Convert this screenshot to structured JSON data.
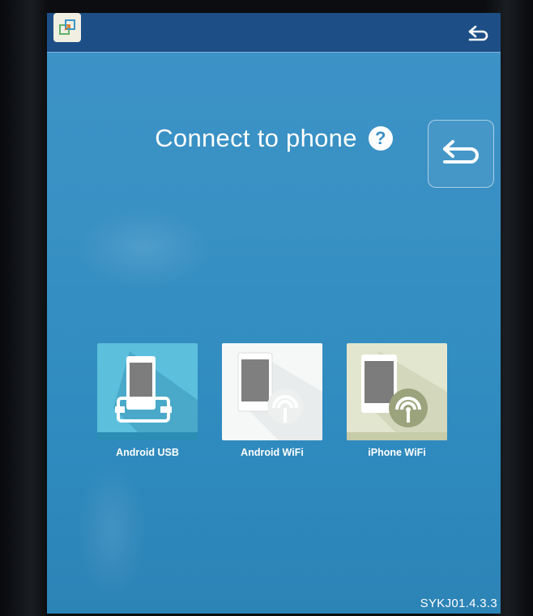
{
  "page": {
    "title": "Connect to phone",
    "help_symbol": "?",
    "version": "SYKJ01.4.3.3"
  },
  "topbar": {
    "app_icon": "window-switch-icon",
    "back_icon": "back-arrow-icon"
  },
  "back_button": {
    "icon": "back-arrow-icon"
  },
  "options": [
    {
      "label": "Android USB",
      "icon": "phone-usb-icon",
      "tile_color": "#5cc0dc"
    },
    {
      "label": "Android WiFi",
      "icon": "phone-wifi-icon",
      "tile_color": "#f6f7f7"
    },
    {
      "label": "iPhone WiFi",
      "icon": "phone-wifi-icon",
      "tile_color": "#e2e6cf"
    }
  ],
  "colors": {
    "screen_bg": "#3890c3",
    "topbar_bg": "#1d4f86",
    "text": "#ffffff"
  }
}
